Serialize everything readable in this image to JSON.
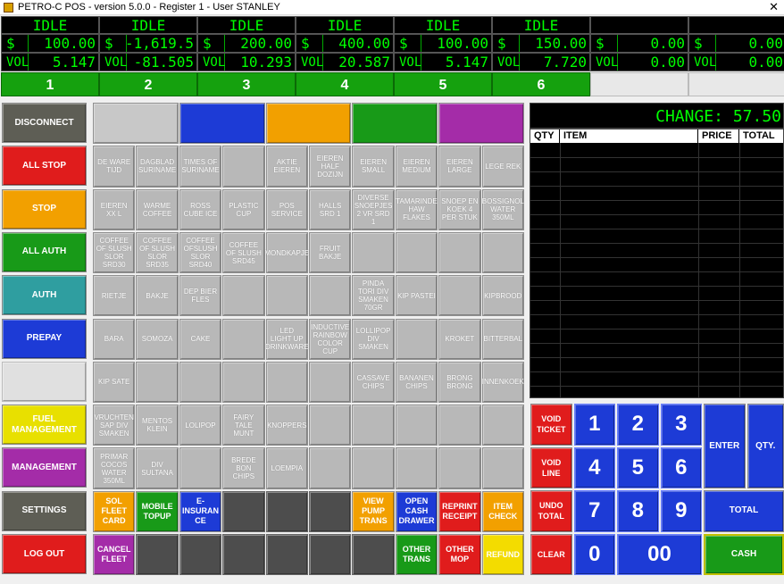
{
  "window": {
    "title": "PETRO-C POS - version 5.0.0 - Register 1 - User STANLEY",
    "close": "✕"
  },
  "pumps": [
    {
      "status": "IDLE",
      "money_label": "$",
      "money": "100.00",
      "vol_label": "VOL",
      "vol": "5.147",
      "number": "1"
    },
    {
      "status": "IDLE",
      "money_label": "$",
      "money": "-1,619.5",
      "vol_label": "VOL",
      "vol": "-81.505",
      "number": "2"
    },
    {
      "status": "IDLE",
      "money_label": "$",
      "money": "200.00",
      "vol_label": "VOL",
      "vol": "10.293",
      "number": "3"
    },
    {
      "status": "IDLE",
      "money_label": "$",
      "money": "400.00",
      "vol_label": "VOL",
      "vol": "20.587",
      "number": "4"
    },
    {
      "status": "IDLE",
      "money_label": "$",
      "money": "100.00",
      "vol_label": "VOL",
      "vol": "5.147",
      "number": "5"
    },
    {
      "status": "IDLE",
      "money_label": "$",
      "money": "150.00",
      "vol_label": "VOL",
      "vol": "7.720",
      "number": "6"
    },
    {
      "status": "",
      "money_label": "$",
      "money": "0.00",
      "vol_label": "VOL",
      "vol": "0.00",
      "number": ""
    },
    {
      "status": "",
      "money_label": "$",
      "money": "0.00",
      "vol_label": "VOL",
      "vol": "0.00",
      "number": ""
    }
  ],
  "left_buttons": [
    "DISCONNECT",
    "ALL STOP",
    "STOP",
    "ALL AUTH",
    "AUTH",
    "PREPAY",
    "",
    "FUEL\nMANAGEMENT",
    "MANAGEMENT",
    "SETTINGS",
    "LOG OUT"
  ],
  "grid": [
    [
      "DE WARE\nTIJD",
      "DAGBLAD\nSURINAME",
      "TIMES OF\nSURINAME",
      "",
      "AKTIE\nEIEREN",
      "EIEREN\nHALF\nDOZIJN",
      "EIEREN\nSMALL",
      "EIEREN\nMEDIUM",
      "EIEREN\nLARGE",
      "LEGE REK"
    ],
    [
      "EIEREN\nXX L",
      "WARME\nCOFFEE",
      "ROSS\nCUBE ICE",
      "PLASTIC\nCUP",
      "POS\nSERVICE",
      "HALLS\nSRD 1",
      "DIVERSE\nSNOEPJES\n2 VR SRD\n1",
      "TAMARINDE\nHAW\nFLAKES",
      "SNOEP EN\nKOEK 4\nPER STUK",
      "BOSSIGNOL\nWATER\n350ML"
    ],
    [
      "COFFEE\nOF SLUSH\nSLOR\nSRD30",
      "COFFEE\nOF SLUSH\nSLOR\nSRD35",
      "COFFEE\nOFSLUSH\nSLOR\nSRD40",
      "COFFEE\nOF SLUSH\nSRD45",
      "MONDKAPJE",
      "FRUIT\nBAKJE",
      "",
      "",
      "",
      ""
    ],
    [
      "RIETJE",
      "BAKJE",
      "DEP BIER\nFLES",
      "",
      "",
      "",
      "PINDA\nTORI DIV\nSMAKEN\n70GR",
      "KIP PASTEI",
      "",
      "KIPBROOD"
    ],
    [
      "BARA",
      "SOMOZA",
      "CAKE",
      "",
      "LED\nLIGHT UP\nDRINKWARE",
      "INDUCTIVE\nRAINBOW\nCOLOR\nCUP",
      "LOLLIPOP\nDIV\nSMAKEN",
      "",
      "KROKET",
      "BITTERBAL"
    ],
    [
      "KIP SATE",
      "",
      "",
      "",
      "",
      "",
      "CASSAVE\nCHIPS",
      "BANANEN\nCHIPS",
      "BRONG\nBRONG",
      "INNENKOEK"
    ],
    [
      "VRUCHTEN\nSAP DIV\nSMAKEN",
      "MENTOS\nKLEIN",
      "LOLIPOP",
      "FAIRY\nTALE\nMUNT",
      "KNOPPERS",
      "",
      "",
      "",
      "",
      ""
    ],
    [
      "PRIMAR\nCOCOS\nWATER\n350ML",
      "DIV\nSULTANA",
      "",
      "BREDE\nBON\nCHIPS",
      "LOEMPIA",
      "",
      "",
      "",
      "",
      ""
    ]
  ],
  "bottom_row1": [
    "SOL\nFLEET\nCARD",
    "MOBILE\nTOPUP",
    "E-\nINSURAN\nCE",
    "",
    "",
    "",
    "VIEW\nPUMP\nTRANS",
    "OPEN\nCASH\nDRAWER",
    "REPRINT\nRECEIPT",
    "ITEM\nCHECK"
  ],
  "bottom_row2": [
    "CANCEL\nFLEET",
    "",
    "",
    "",
    "",
    "",
    "",
    "OTHER\nTRANS",
    "OTHER\nMOP",
    "REFUND"
  ],
  "change": {
    "label": "CHANGE:",
    "value": "57.50"
  },
  "table": {
    "cols": [
      "QTY",
      "ITEM",
      "PRICE",
      "TOTAL"
    ]
  },
  "keypad": {
    "void_ticket": "VOID\nTICKET",
    "void_line": "VOID\nLINE",
    "undo_total": "UNDO\nTOTAL",
    "clear": "CLEAR",
    "digits": [
      "1",
      "2",
      "3",
      "4",
      "5",
      "6",
      "7",
      "8",
      "9",
      "0",
      "00"
    ],
    "enter": "ENTER",
    "qty": "QTY.",
    "total": "TOTAL",
    "cash": "CASH"
  }
}
